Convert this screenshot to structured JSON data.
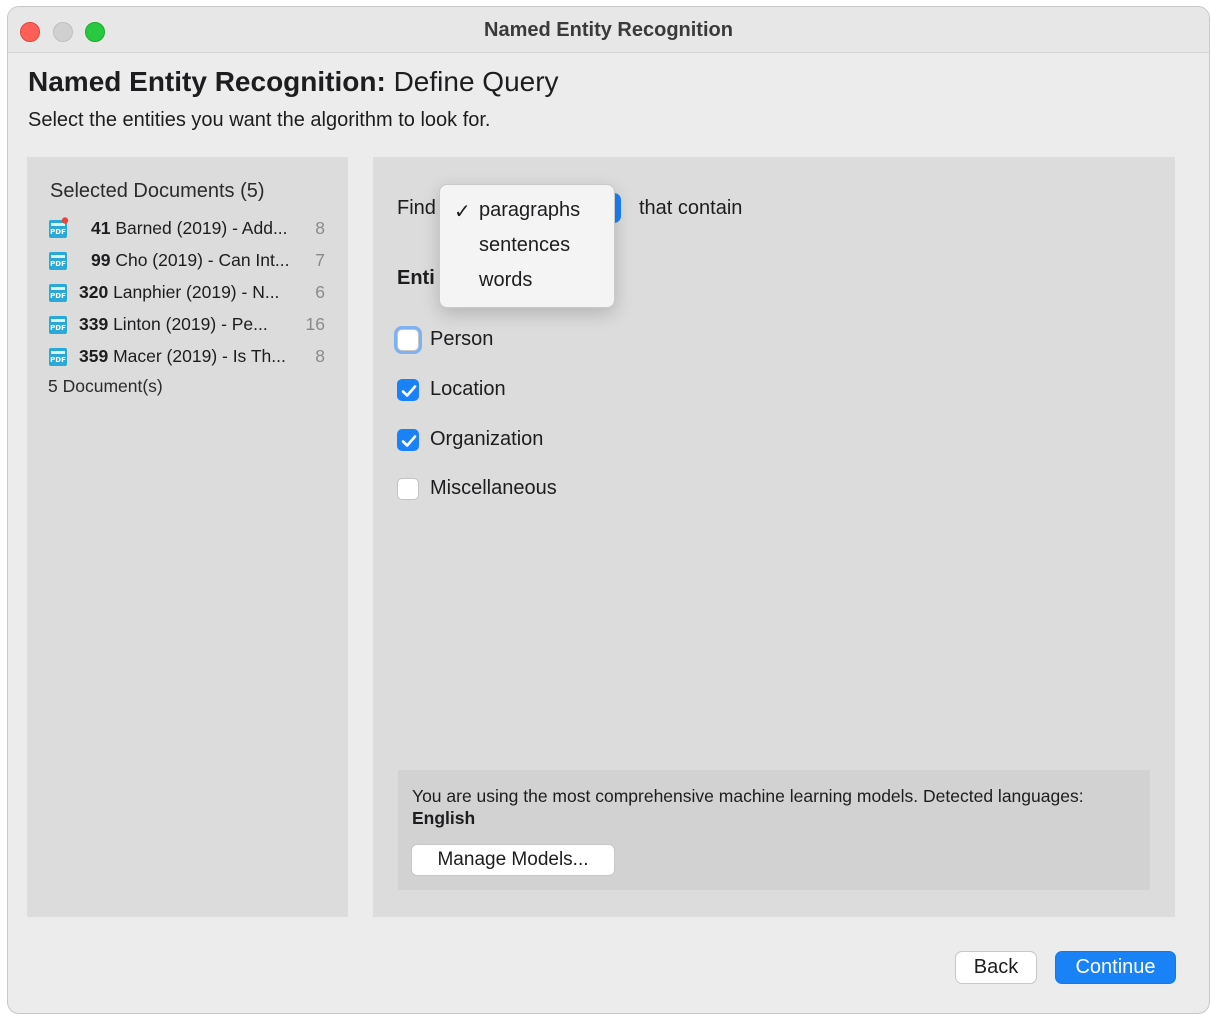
{
  "window": {
    "title": "Named Entity Recognition"
  },
  "header": {
    "title_bold": "Named Entity Recognition:",
    "title_rest": " Define Query",
    "subtitle": "Select the entities you want the algorithm to look for."
  },
  "documents": {
    "title": "Selected Documents (5)",
    "items": [
      {
        "number": "41",
        "title": "Barned (2019) - Add...",
        "count": "8",
        "icon": "pdf-icon",
        "has_badge": true
      },
      {
        "number": "99",
        "title": "Cho (2019) - Can Int...",
        "count": "7",
        "icon": "pdf-icon",
        "has_badge": false
      },
      {
        "number": "320",
        "title": "Lanphier (2019) - N...",
        "count": "6",
        "icon": "pdf-icon",
        "has_badge": false
      },
      {
        "number": "339",
        "title": "Linton (2019) - Pe...",
        "count": "16",
        "icon": "pdf-icon",
        "has_badge": false
      },
      {
        "number": "359",
        "title": "Macer (2019) - Is Th...",
        "count": "8",
        "icon": "pdf-icon",
        "has_badge": false
      }
    ],
    "footer": "5 Document(s)"
  },
  "query": {
    "find_label": "Find",
    "contain_label": "that contain",
    "entities_label": "Enti",
    "dropdown": {
      "selected": "paragraphs",
      "options": [
        "paragraphs",
        "sentences",
        "words"
      ]
    },
    "entities": [
      {
        "label": "Person",
        "checked": false,
        "focused": true
      },
      {
        "label": "Location",
        "checked": true,
        "focused": false
      },
      {
        "label": "Organization",
        "checked": true,
        "focused": false
      },
      {
        "label": "Miscellaneous",
        "checked": false,
        "focused": false
      }
    ]
  },
  "info": {
    "text_prefix": "You are using the most comprehensive machine learning models. Detected languages: ",
    "language": "English",
    "manage_button": "Manage Models..."
  },
  "footer_buttons": {
    "back": "Back",
    "continue": "Continue"
  },
  "colors": {
    "accent": "#1a82f7",
    "close": "#fe5f57",
    "maximize": "#28c840",
    "badge": "#e8453c",
    "pdf_icon": "#29a9d8"
  }
}
